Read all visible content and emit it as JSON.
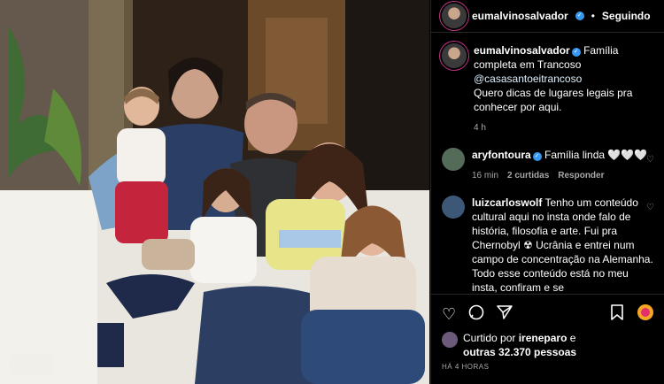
{
  "header": {
    "username": "eumalvinosalvador",
    "dot": "•",
    "follow_status": "Seguindo"
  },
  "caption": {
    "username": "eumalvinosalvador",
    "text_1": "Família completa em Trancoso",
    "mention": "@casasantoeitrancoso",
    "text_2": "Quero dicas de lugares legais pra conhecer por aqui.",
    "time": "4 h"
  },
  "comments": [
    {
      "username": "aryfontoura",
      "text": "Família linda 🤍🤍🤍",
      "time": "16 min",
      "likes": "2 curtidas",
      "reply": "Responder"
    },
    {
      "username": "luizcarloswolf",
      "text": "Tenho um conteúdo cultural aqui no insta onde falo de história, filosofia e arte. Fui pra Chernobyl ☢ Ucrânia e entrei num campo de concentração na Alemanha. Todo esse conteúdo está no meu insta, confiram e se"
    }
  ],
  "likes": {
    "prefix": "Curtido por",
    "user": "ireneparo",
    "connector": "e",
    "others": "outras 32.370 pessoas"
  },
  "posted": "HÁ 4 HORAS",
  "icons": [
    "heart-icon",
    "comment-icon",
    "share-icon",
    "bookmark-icon",
    "sticker-icon"
  ]
}
